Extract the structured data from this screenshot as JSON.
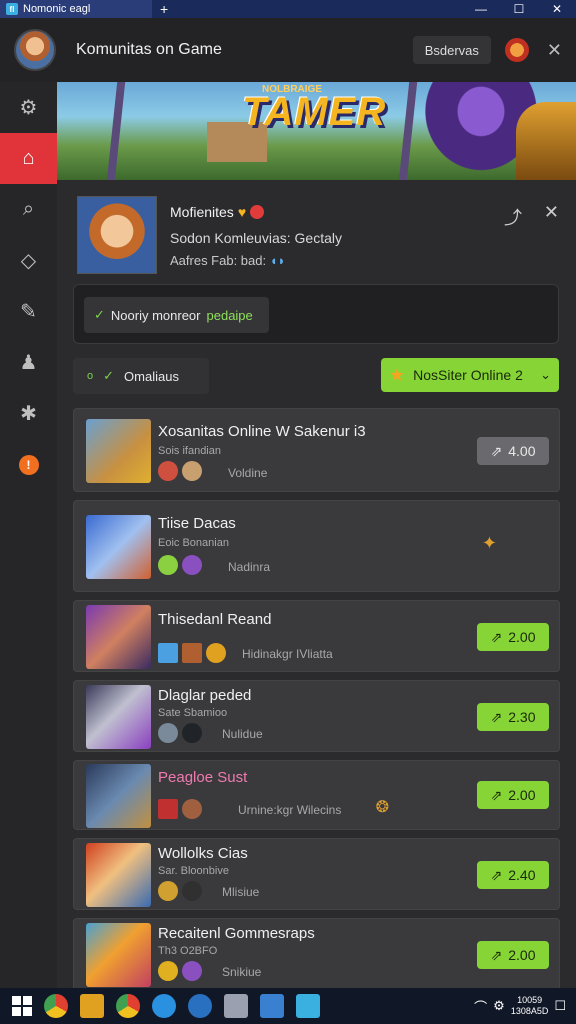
{
  "window": {
    "tab_title": "Nomonic eagl",
    "new_tab": "+",
    "minimize": "—",
    "maximize": "☐",
    "close": "✕"
  },
  "header": {
    "title": "Komunitas on Game",
    "button": "Bsdervas",
    "close": "✕"
  },
  "sidebar": {
    "items": [
      {
        "name": "settings",
        "icon": "⚙"
      },
      {
        "name": "home",
        "icon": "⌂"
      },
      {
        "name": "search",
        "icon": "⌕"
      },
      {
        "name": "cube",
        "icon": "◇"
      },
      {
        "name": "chat",
        "icon": "✎"
      },
      {
        "name": "user",
        "icon": "♟"
      },
      {
        "name": "puzzle",
        "icon": "✱"
      },
      {
        "name": "notification",
        "icon": "!"
      }
    ]
  },
  "banner": {
    "logo_sub": "NOLBRAIGE",
    "logo": "TAMER"
  },
  "profile": {
    "name": "Mofienites",
    "heart": "♥",
    "line1": "Sodon Komleuvias: Gectaly",
    "line2_text": "Aafres Fab: bad:",
    "line2_icon": "◖◗",
    "action_pin": "⤴",
    "action_close": "✕"
  },
  "status": {
    "check": "✓",
    "text": "Nooriy monreor",
    "highlight": "pedaipe"
  },
  "filter": {
    "dot": "o",
    "check": "✓",
    "label": "Omaliaus"
  },
  "dropdown": {
    "star": "★",
    "label": "NosSiter Online 2",
    "chevron": "⌄"
  },
  "games": [
    {
      "title": "Xosanitas Online W Sakenur i3",
      "subtitle": "Sois ifandian",
      "tag": "Voldine",
      "price": "4.00",
      "price_style": "gry"
    },
    {
      "title": "Tiise Dacas",
      "subtitle": "Eoic Bonanian",
      "tag": "Nadinra",
      "price": "",
      "price_style": "none"
    },
    {
      "title": "Thisedanl Reand",
      "subtitle": "",
      "tag": "Hidinakgr IVliatta",
      "price": "2.00",
      "price_style": "grn"
    },
    {
      "title": "Dlaglar peded",
      "subtitle": "Sate Sbamioo",
      "tag": "Nulidue",
      "price": "2.30",
      "price_style": "grn"
    },
    {
      "title": "Peagloe Sust",
      "subtitle": "",
      "tag": "Urnine:kgr Wilecins",
      "price": "2.00",
      "price_style": "grn"
    },
    {
      "title": "Wollolks Cias",
      "subtitle": "Sar. Bloonbive",
      "tag": "Mlisiue",
      "price": "2.40",
      "price_style": "grn"
    },
    {
      "title": "Recaitenl Gommesraps",
      "subtitle": "Th3 O2BFO",
      "tag": "Snikiue",
      "price": "2.00",
      "price_style": "grn"
    }
  ],
  "price_icon": "⇗",
  "taskbar": {
    "clock_line1": "10059",
    "clock_line2": "1308A5D"
  },
  "colors": {
    "accent_green": "#86d435",
    "active_red": "#e0343a",
    "pink_title": "#f07ab0"
  }
}
